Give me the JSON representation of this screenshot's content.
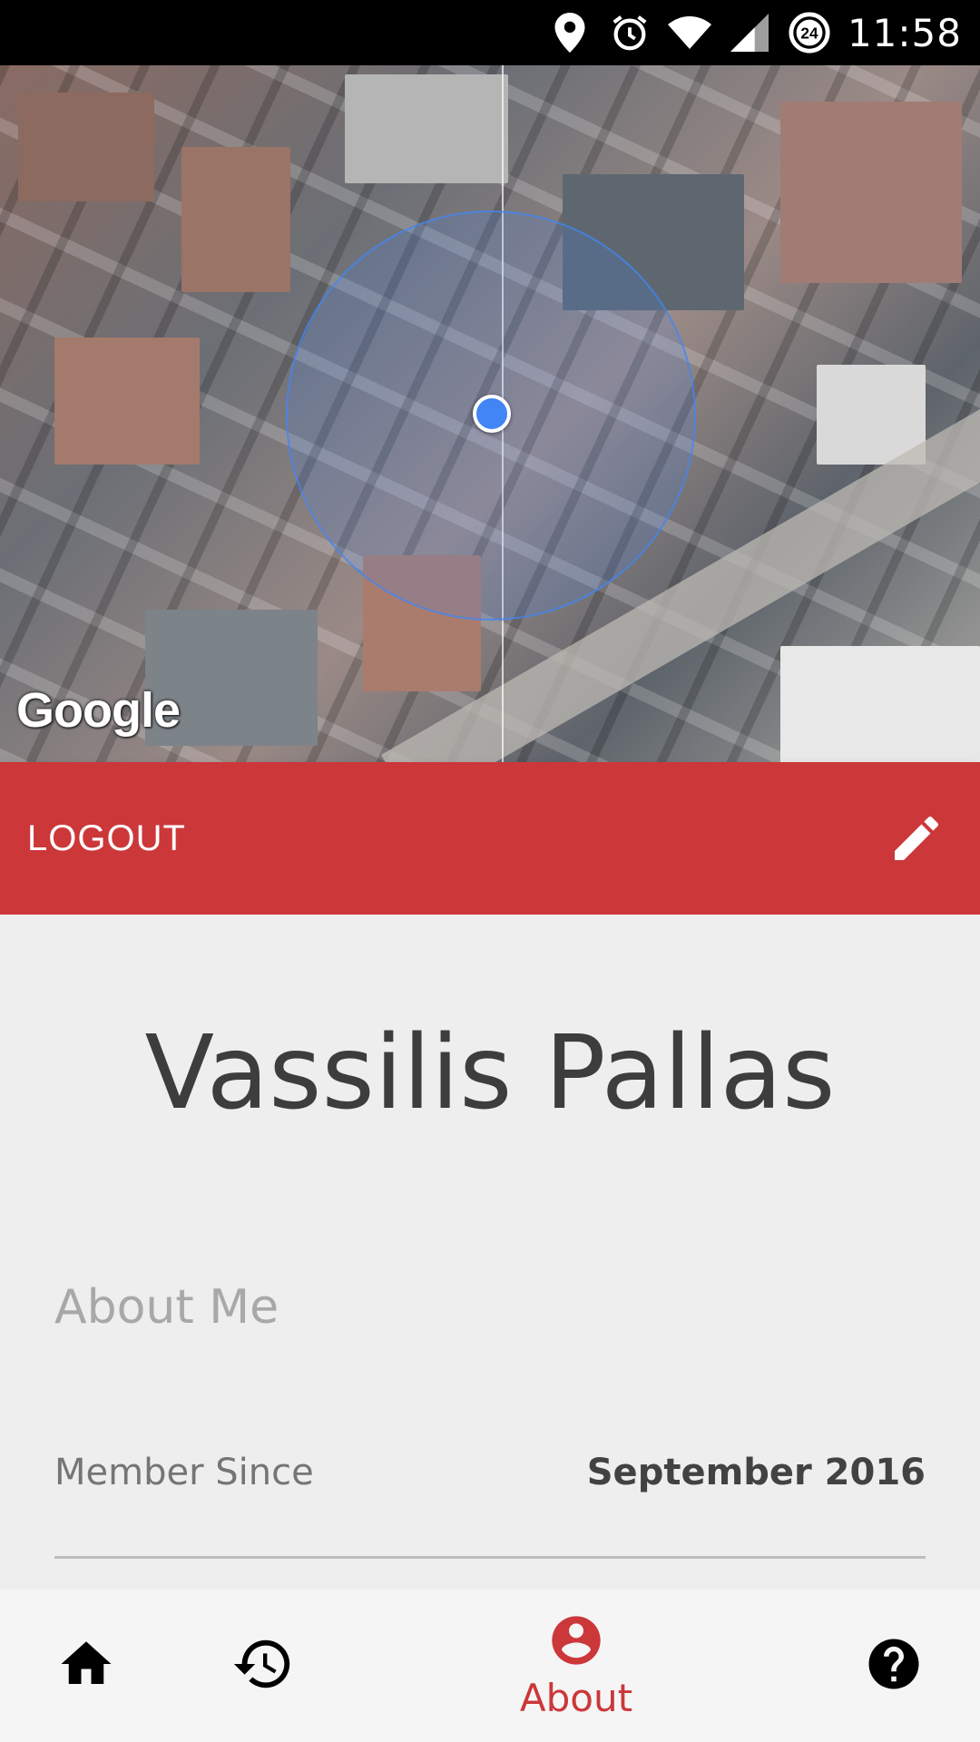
{
  "status_bar": {
    "time": "11:58",
    "icons": [
      "location-icon",
      "alarm-icon",
      "wifi-icon",
      "signal-icon",
      "data-saver-icon"
    ],
    "badge": "24"
  },
  "map": {
    "attribution": "Google"
  },
  "action_bar": {
    "logout_label": "LOGOUT",
    "edit_icon": "pencil-icon",
    "color": "#cc373a"
  },
  "profile": {
    "name": "Vassilis Pallas",
    "about_heading": "About Me",
    "member_since_label": "Member Since",
    "member_since_value": "September 2016"
  },
  "bottom_nav": {
    "items": [
      {
        "icon": "home-icon",
        "label": ""
      },
      {
        "icon": "history-icon",
        "label": ""
      },
      {
        "icon": "account-icon",
        "label": "About",
        "active": true
      },
      {
        "icon": "help-icon",
        "label": ""
      }
    ],
    "active_color": "#cc373a"
  }
}
